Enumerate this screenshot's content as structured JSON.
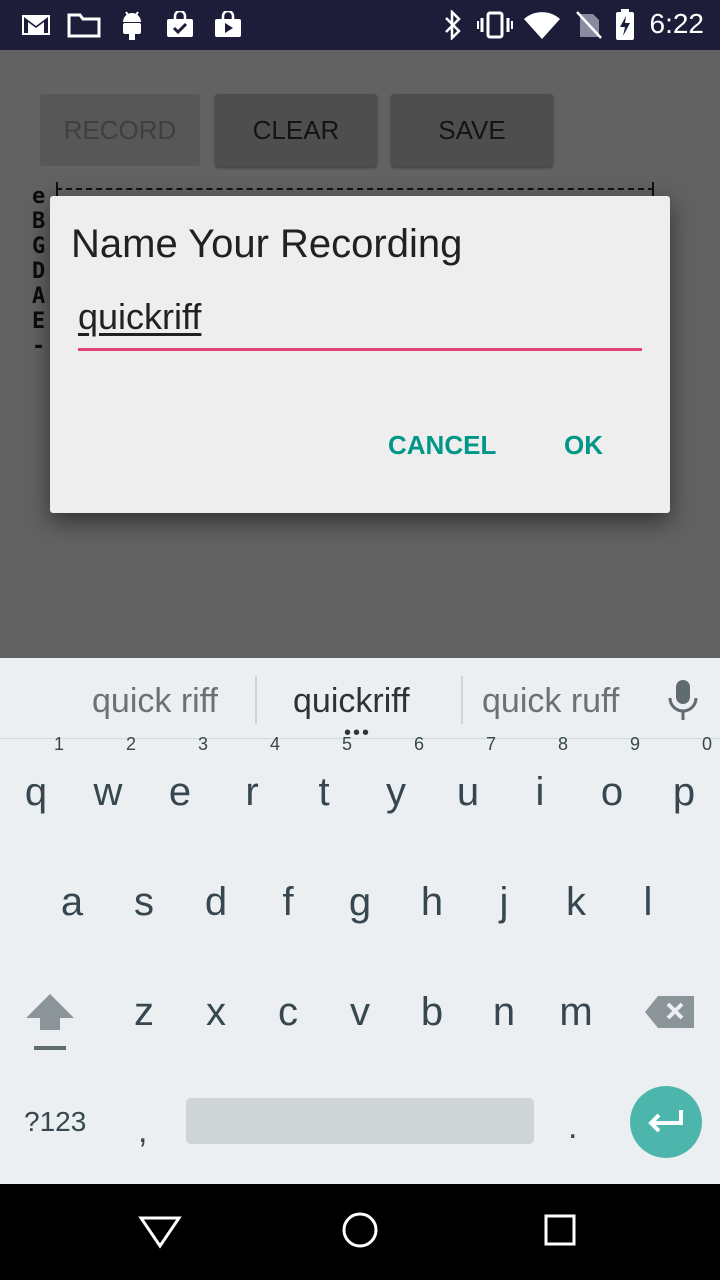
{
  "status_bar": {
    "time": "6:22",
    "left_icons": [
      "gmail-icon",
      "folder-icon",
      "android-icon",
      "shopping-bag-icon",
      "play-store-icon"
    ],
    "right_icons": [
      "bluetooth-icon",
      "vibrate-icon",
      "wifi-icon",
      "no-sim-icon",
      "battery-charging-icon"
    ]
  },
  "app": {
    "buttons": {
      "record": "RECORD",
      "clear": "CLEAR",
      "save": "SAVE"
    },
    "tab_strings": [
      "e",
      "B",
      "G",
      "D",
      "A",
      "E",
      "-"
    ]
  },
  "dialog": {
    "title": "Name Your Recording",
    "input_value": "quickriff",
    "cancel": "CANCEL",
    "ok": "OK",
    "accent_color": "#e0457b",
    "button_color": "#009688"
  },
  "keyboard": {
    "suggestions": [
      "quick riff",
      "quickriff",
      "quick ruff"
    ],
    "row1": [
      {
        "key": "q",
        "num": "1"
      },
      {
        "key": "w",
        "num": "2"
      },
      {
        "key": "e",
        "num": "3"
      },
      {
        "key": "r",
        "num": "4"
      },
      {
        "key": "t",
        "num": "5"
      },
      {
        "key": "y",
        "num": "6"
      },
      {
        "key": "u",
        "num": "7"
      },
      {
        "key": "i",
        "num": "8"
      },
      {
        "key": "o",
        "num": "9"
      },
      {
        "key": "p",
        "num": "0"
      }
    ],
    "row2": [
      "a",
      "s",
      "d",
      "f",
      "g",
      "h",
      "j",
      "k",
      "l"
    ],
    "row3": [
      "z",
      "x",
      "c",
      "v",
      "b",
      "n",
      "m"
    ],
    "symbols": "?123",
    "comma": ",",
    "period": ".",
    "enter_color": "#4cb6ac"
  },
  "nav": {
    "icons": [
      "back-icon",
      "home-icon",
      "recents-icon"
    ]
  }
}
